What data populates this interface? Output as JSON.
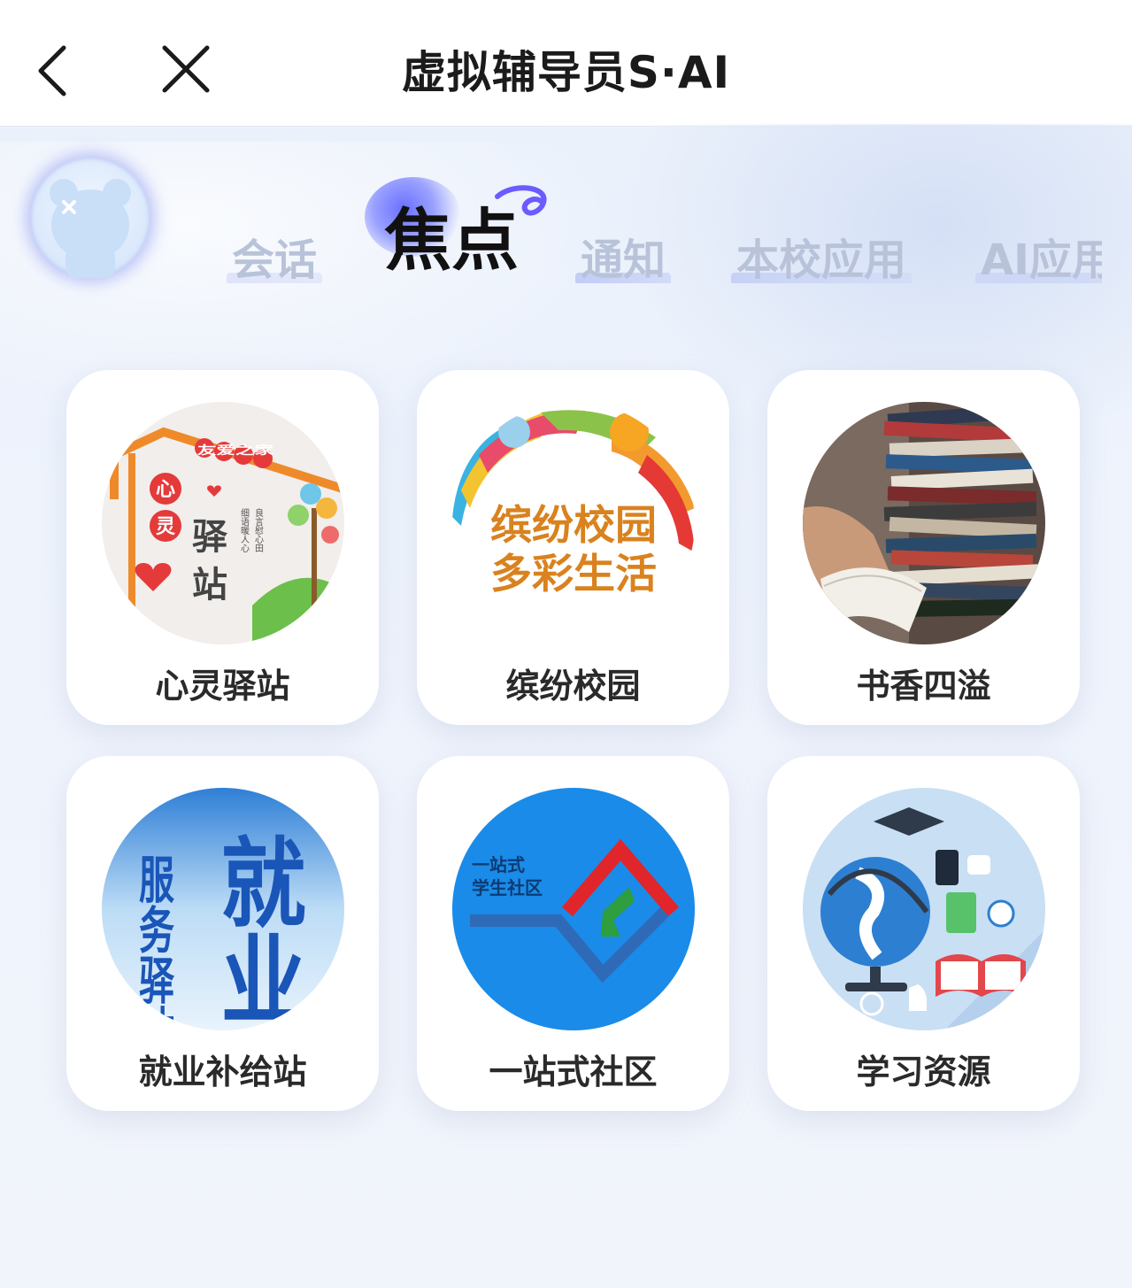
{
  "header": {
    "title": "虚拟辅导员S·AI",
    "back_icon": "chevron-left-icon",
    "close_icon": "close-icon"
  },
  "tabs": [
    {
      "label": "会话",
      "active": false
    },
    {
      "label": "焦点",
      "active": true
    },
    {
      "label": "通知",
      "active": false
    },
    {
      "label": "本校应用",
      "active": false
    },
    {
      "label": "AI应用",
      "active": false
    }
  ],
  "cards": [
    {
      "label": "心灵驿站",
      "thumb": {
        "sign": "友爱之家",
        "heart_chars": [
          "心",
          "灵"
        ],
        "big_chars": [
          "驿",
          "站"
        ],
        "motto_1": "细语暖人心",
        "motto_2": "良言慰心田"
      }
    },
    {
      "label": "缤纷校园",
      "thumb": {
        "line1": "缤纷校园",
        "line2": "多彩生活"
      }
    },
    {
      "label": "书香四溢"
    },
    {
      "label": "就业补给站",
      "thumb": {
        "small": "服务驿站",
        "big": "就业"
      }
    },
    {
      "label": "一站式社区",
      "thumb": {
        "line1": "一站式",
        "line2": "学生社区"
      }
    },
    {
      "label": "学习资源"
    }
  ],
  "colors": {
    "accent": "#6a70ff",
    "tab_inactive": "#b8c3d9",
    "card_label": "#2a2a2a"
  }
}
